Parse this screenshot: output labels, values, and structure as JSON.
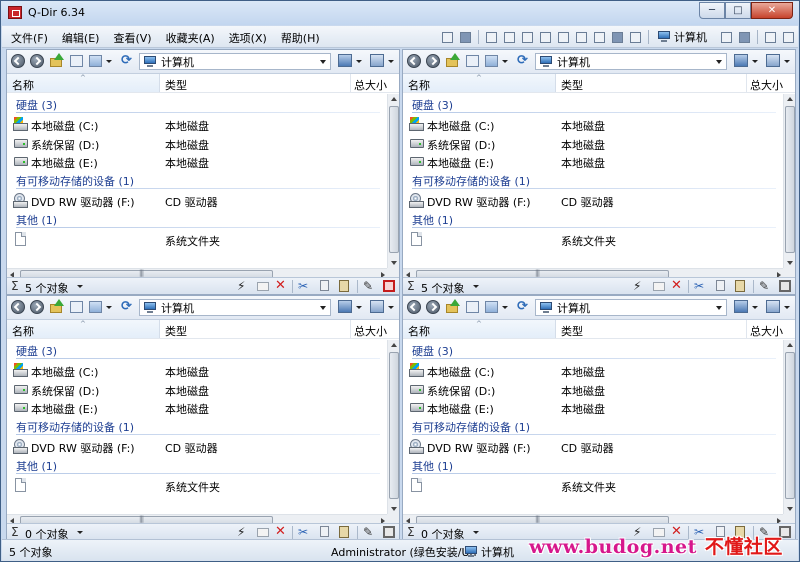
{
  "app": {
    "title": "Q-Dir 6.34",
    "title_buttons": {
      "minimize": "─",
      "maximize": "□",
      "close": "✕"
    }
  },
  "menu": {
    "items": [
      {
        "label": "文件(F)"
      },
      {
        "label": "编辑(E)"
      },
      {
        "label": "查看(V)"
      },
      {
        "label": "收藏夹(A)"
      },
      {
        "label": "选项(X)"
      },
      {
        "label": "帮助(H)"
      }
    ],
    "location_label": "计算机"
  },
  "columns": {
    "name": "名称",
    "type": "类型",
    "size": "总大小"
  },
  "panes": [
    {
      "address": "计算机",
      "groups": [
        {
          "label": "硬盘 (3)",
          "items": [
            {
              "name": "本地磁盘 (C:)",
              "type": "本地磁盘",
              "icon": "system-drive-icon"
            },
            {
              "name": "系统保留 (D:)",
              "type": "本地磁盘",
              "icon": "hard-drive-icon"
            },
            {
              "name": "本地磁盘 (E:)",
              "type": "本地磁盘",
              "icon": "hard-drive-icon"
            }
          ]
        },
        {
          "label": "有可移动存储的设备 (1)",
          "items": [
            {
              "name": "DVD RW 驱动器 (F:)",
              "type": "CD 驱动器",
              "icon": "cd-drive-icon"
            }
          ]
        },
        {
          "label": "其他 (1)",
          "items": [
            {
              "name": "",
              "type": "系统文件夹",
              "icon": "file-icon"
            }
          ]
        }
      ],
      "status": "5 个对象",
      "active": true
    },
    {
      "address": "计算机",
      "groups": [
        {
          "label": "硬盘 (3)",
          "items": [
            {
              "name": "本地磁盘 (C:)",
              "type": "本地磁盘",
              "icon": "system-drive-icon"
            },
            {
              "name": "系统保留 (D:)",
              "type": "本地磁盘",
              "icon": "hard-drive-icon"
            },
            {
              "name": "本地磁盘 (E:)",
              "type": "本地磁盘",
              "icon": "hard-drive-icon"
            }
          ]
        },
        {
          "label": "有可移动存储的设备 (1)",
          "items": [
            {
              "name": "DVD RW 驱动器 (F:)",
              "type": "CD 驱动器",
              "icon": "cd-drive-icon"
            }
          ]
        },
        {
          "label": "其他 (1)",
          "items": [
            {
              "name": "",
              "type": "系统文件夹",
              "icon": "file-icon"
            }
          ]
        }
      ],
      "status": "5 个对象",
      "active": false
    },
    {
      "address": "计算机",
      "groups": [
        {
          "label": "硬盘 (3)",
          "items": [
            {
              "name": "本地磁盘 (C:)",
              "type": "本地磁盘",
              "icon": "system-drive-icon"
            },
            {
              "name": "系统保留 (D:)",
              "type": "本地磁盘",
              "icon": "hard-drive-icon"
            },
            {
              "name": "本地磁盘 (E:)",
              "type": "本地磁盘",
              "icon": "hard-drive-icon"
            }
          ]
        },
        {
          "label": "有可移动存储的设备 (1)",
          "items": [
            {
              "name": "DVD RW 驱动器 (F:)",
              "type": "CD 驱动器",
              "icon": "cd-drive-icon"
            }
          ]
        },
        {
          "label": "其他 (1)",
          "items": [
            {
              "name": "",
              "type": "系统文件夹",
              "icon": "file-icon"
            }
          ]
        }
      ],
      "status": "0 个对象",
      "active": false
    },
    {
      "address": "计算机",
      "groups": [
        {
          "label": "硬盘 (3)",
          "items": [
            {
              "name": "本地磁盘 (C:)",
              "type": "本地磁盘",
              "icon": "system-drive-icon"
            },
            {
              "name": "系统保留 (D:)",
              "type": "本地磁盘",
              "icon": "hard-drive-icon"
            },
            {
              "name": "本地磁盘 (E:)",
              "type": "本地磁盘",
              "icon": "hard-drive-icon"
            }
          ]
        },
        {
          "label": "有可移动存储的设备 (1)",
          "items": [
            {
              "name": "DVD RW 驱动器 (F:)",
              "type": "CD 驱动器",
              "icon": "cd-drive-icon"
            }
          ]
        },
        {
          "label": "其他 (1)",
          "items": [
            {
              "name": "",
              "type": "系统文件夹",
              "icon": "file-icon"
            }
          ]
        }
      ],
      "status": "0 个对象",
      "active": false
    }
  ],
  "statusbar": {
    "count": "5 个对象",
    "user": "Administrator (绿色安装/Un",
    "location": "计算机"
  },
  "watermark": {
    "site": "www.budog.net",
    "brand": "不懂社区"
  },
  "colors": {
    "group_text": "#1e3f92",
    "accent_close": "#c7432c",
    "watermark_site": "#d6188c",
    "watermark_brand": "#e11818"
  }
}
